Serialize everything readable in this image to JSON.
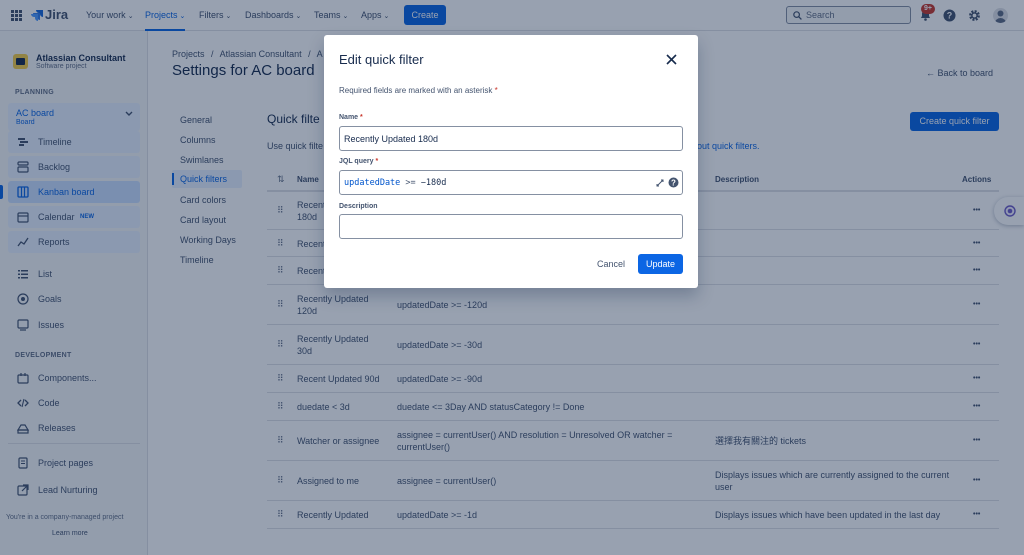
{
  "nav": {
    "logo": "Jira",
    "items": [
      {
        "label": "Your work"
      },
      {
        "label": "Projects"
      },
      {
        "label": "Filters"
      },
      {
        "label": "Dashboards"
      },
      {
        "label": "Teams"
      },
      {
        "label": "Apps"
      }
    ],
    "create_label": "Create",
    "search_placeholder": "Search",
    "notification_badge": "9+"
  },
  "sidebar": {
    "project_name": "Atlassian Consultant",
    "project_type": "Software project",
    "planning_heading": "PLANNING",
    "board_name": "AC board",
    "board_sub": "Board",
    "planning_items": [
      {
        "label": "Timeline",
        "icon": "timeline-icon"
      },
      {
        "label": "Backlog",
        "icon": "backlog-icon"
      },
      {
        "label": "Kanban board",
        "icon": "board-icon"
      },
      {
        "label": "Calendar",
        "icon": "calendar-icon",
        "badge": "NEW"
      },
      {
        "label": "Reports",
        "icon": "reports-icon"
      }
    ],
    "other_items": [
      {
        "label": "List",
        "icon": "list-icon"
      },
      {
        "label": "Goals",
        "icon": "goals-icon"
      },
      {
        "label": "Issues",
        "icon": "issues-icon"
      }
    ],
    "development_heading": "DEVELOPMENT",
    "development_items": [
      {
        "label": "Components...",
        "icon": "components-icon"
      },
      {
        "label": "Code",
        "icon": "code-icon"
      },
      {
        "label": "Releases",
        "icon": "releases-icon"
      }
    ],
    "bottom_items": [
      {
        "label": "Project pages",
        "icon": "pages-icon"
      },
      {
        "label": "Lead Nurturing",
        "icon": "shortcut-icon"
      }
    ],
    "footer_text": "You're in a company-managed project",
    "learn_more": "Learn more"
  },
  "page": {
    "breadcrumbs": [
      "Projects",
      "/",
      "Atlassian Consultant",
      "/",
      "A"
    ],
    "title": "Settings for AC board",
    "back_link": "← Back to board",
    "settings_nav": [
      "General",
      "Columns",
      "Swimlanes",
      "Quick filters",
      "Card colors",
      "Card layout",
      "Working Days",
      "Timeline"
    ],
    "section_title": "Quick filte",
    "intro_text": "Use quick filte",
    "intro_link": "out quick filters.",
    "create_button": "Create quick filter"
  },
  "table": {
    "headers": {
      "name": "Name",
      "description": "Description",
      "actions": "Actions"
    },
    "rows": [
      {
        "name": "Recent\n180d",
        "jql": "",
        "description": ""
      },
      {
        "name": "Recent",
        "jql": "",
        "description": ""
      },
      {
        "name": "Recent",
        "jql": "",
        "description": ""
      },
      {
        "name": "Recently Updated\n120d",
        "jql": "updatedDate >= -120d",
        "description": ""
      },
      {
        "name": "Recently Updated\n30d",
        "jql": "updatedDate >= -30d",
        "description": ""
      },
      {
        "name": "Recent Updated 90d",
        "jql": "updatedDate >= -90d",
        "description": ""
      },
      {
        "name": "duedate < 3d",
        "jql": "duedate <= 3Day AND statusCategory != Done",
        "description": ""
      },
      {
        "name": "Watcher or assignee",
        "jql": "assignee = currentUser() AND resolution = Unresolved OR watcher =\ncurrentUser()",
        "description": "選擇我有關注的 tickets"
      },
      {
        "name": "Assigned to me",
        "jql": "assignee = currentUser()",
        "description": "Displays issues which are currently assigned to the current\nuser"
      },
      {
        "name": "Recently Updated",
        "jql": "updatedDate >= -1d",
        "description": "Displays issues which have been updated in the last day"
      }
    ]
  },
  "modal": {
    "title": "Edit quick filter",
    "required_note": "Required fields are marked with an asterisk",
    "asterisk": "*",
    "name_label": "Name",
    "name_value": "Recently Updated 180d",
    "jql_label": "JQL query",
    "jql_field": "updatedDate",
    "jql_operator": ">=",
    "jql_value": "−180d",
    "description_label": "Description",
    "description_value": "",
    "cancel_label": "Cancel",
    "update_label": "Update"
  },
  "colors": {
    "brand": "#0c66e4",
    "overlay": "#091e42",
    "required": "#c9372c"
  }
}
